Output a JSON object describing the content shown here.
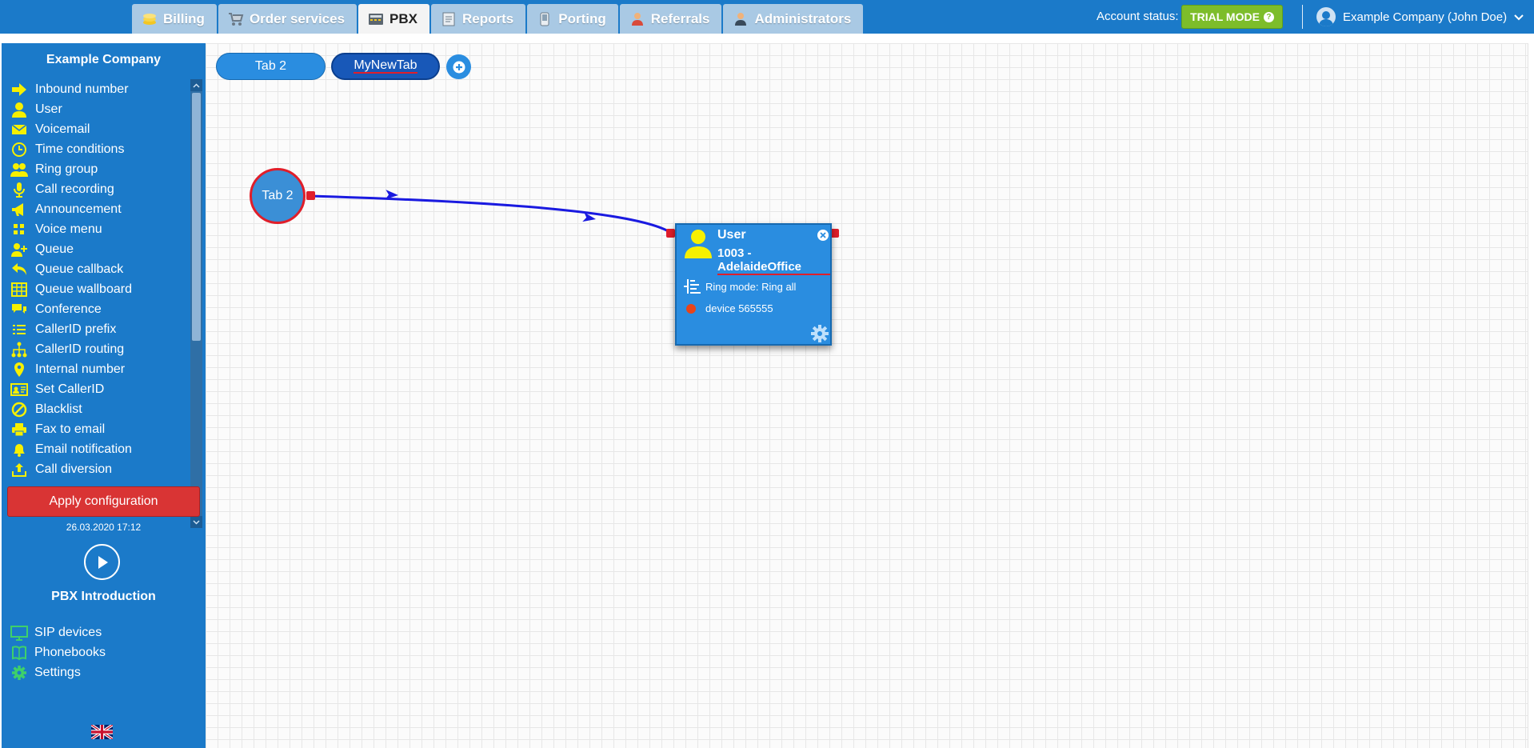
{
  "topnav": {
    "tabs": [
      {
        "label": "Billing",
        "icon": "billing-icon"
      },
      {
        "label": "Order services",
        "icon": "cart-icon"
      },
      {
        "label": "PBX",
        "icon": "pbx-icon"
      },
      {
        "label": "Reports",
        "icon": "reports-icon"
      },
      {
        "label": "Porting",
        "icon": "porting-icon"
      },
      {
        "label": "Referrals",
        "icon": "referrals-icon"
      },
      {
        "label": "Administrators",
        "icon": "administrators-icon"
      }
    ],
    "active_tab": "PBX",
    "account_status_label": "Account status:",
    "trial_button": "TRIAL MODE",
    "trial_help": "?",
    "user_menu": "Example Company (John Doe)"
  },
  "sidebar": {
    "company": "Example Company",
    "items": [
      {
        "label": "Inbound number",
        "icon": "arrow-right-icon"
      },
      {
        "label": "User",
        "icon": "user-icon"
      },
      {
        "label": "Voicemail",
        "icon": "envelope-icon"
      },
      {
        "label": "Time conditions",
        "icon": "clock-icon"
      },
      {
        "label": "Ring group",
        "icon": "users-icon"
      },
      {
        "label": "Call recording",
        "icon": "microphone-icon"
      },
      {
        "label": "Announcement",
        "icon": "megaphone-icon"
      },
      {
        "label": "Voice menu",
        "icon": "grid-icon"
      },
      {
        "label": "Queue",
        "icon": "user-plus-icon"
      },
      {
        "label": "Queue callback",
        "icon": "reply-icon"
      },
      {
        "label": "Queue wallboard",
        "icon": "table-icon"
      },
      {
        "label": "Conference",
        "icon": "comments-icon"
      },
      {
        "label": "CallerID prefix",
        "icon": "list-icon"
      },
      {
        "label": "CallerID routing",
        "icon": "sitemap-icon"
      },
      {
        "label": "Internal number",
        "icon": "map-pin-icon"
      },
      {
        "label": "Set CallerID",
        "icon": "id-card-icon"
      },
      {
        "label": "Blacklist",
        "icon": "ban-icon"
      },
      {
        "label": "Fax to email",
        "icon": "printer-icon"
      },
      {
        "label": "Email notification",
        "icon": "bell-icon"
      },
      {
        "label": "Call diversion",
        "icon": "share-icon"
      }
    ],
    "apply_button": "Apply configuration",
    "apply_date": "26.03.2020 17:12",
    "intro_label": "PBX Introduction",
    "bottom_items": [
      {
        "label": "SIP devices",
        "icon": "monitor-icon"
      },
      {
        "label": "Phonebooks",
        "icon": "book-icon"
      },
      {
        "label": "Settings",
        "icon": "gear-icon"
      }
    ]
  },
  "canvas": {
    "tabs": [
      {
        "label": "Tab 2"
      },
      {
        "label": "MyNewTab"
      }
    ],
    "active_canvas_tab": "MyNewTab",
    "tab_node": {
      "label": "Tab 2"
    },
    "user_node": {
      "title": "User",
      "name": "1003 - AdelaideOffice",
      "ring_mode": "Ring mode: Ring all",
      "device": "device 565555"
    }
  },
  "colors": {
    "primary": "#1b7ac9",
    "trial": "#7dbd2a",
    "apply": "#d93434",
    "connector": "#1a1ae0",
    "port": "#e01e2a",
    "sidebar_icon": "#f6f000",
    "bottom_icon": "#3ed06a"
  }
}
